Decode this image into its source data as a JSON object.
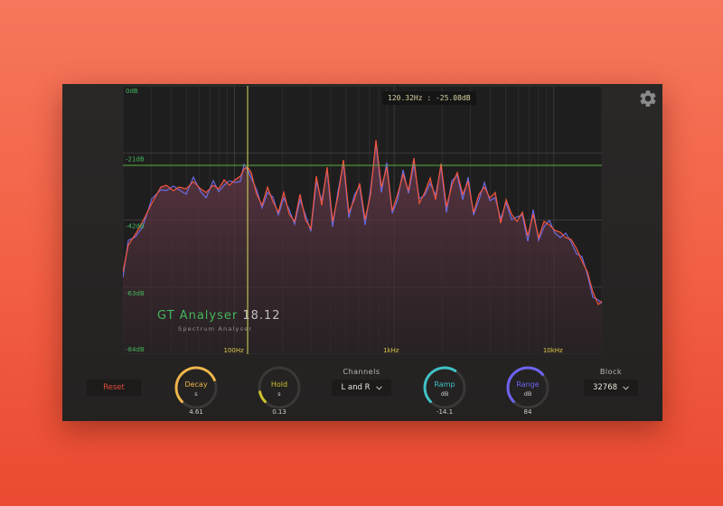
{
  "plugin": {
    "name": "GT Analyser",
    "version": "18.12",
    "subtitle": "Spectrum Analyser"
  },
  "graph": {
    "db_labels": [
      "0dB",
      "-21dB",
      "-42dB",
      "-63dB",
      "-84dB"
    ],
    "freq_labels": [
      "100Hz",
      "1kHz",
      "10kHz"
    ],
    "tooltip": "120.32Hz : -25.08dB",
    "cursor": {
      "freq_hz": 120.32,
      "db": -25.08
    }
  },
  "controls": {
    "reset_label": "Reset",
    "decay": {
      "label": "Decay",
      "unit": "s",
      "value": "4.61",
      "fraction": 0.75
    },
    "hold": {
      "label": "Hold",
      "unit": "s",
      "value": "0.13",
      "fraction": 0.12
    },
    "channels": {
      "label": "Channels",
      "value": "L and R",
      "chevron": "chevron-down-icon"
    },
    "ramp": {
      "label": "Ramp",
      "unit": "dB",
      "value": "-14.1",
      "fraction": 0.62
    },
    "range": {
      "label": "Range",
      "unit": "dB",
      "value": "84",
      "fraction": 0.68
    },
    "block": {
      "label": "Block",
      "value": "32768",
      "chevron": "chevron-down-icon"
    }
  },
  "colors": {
    "accent_green": "#43b65a",
    "left_channel": "#f2553a",
    "right_channel": "#6a6be0",
    "decay_color": "#f0b64a",
    "hold_color": "#cfc12e",
    "ramp_color": "#3fc1c6",
    "range_color": "#6d63f0",
    "reset_color": "#e0483a"
  },
  "icons": {
    "settings": "gear-icon"
  }
}
